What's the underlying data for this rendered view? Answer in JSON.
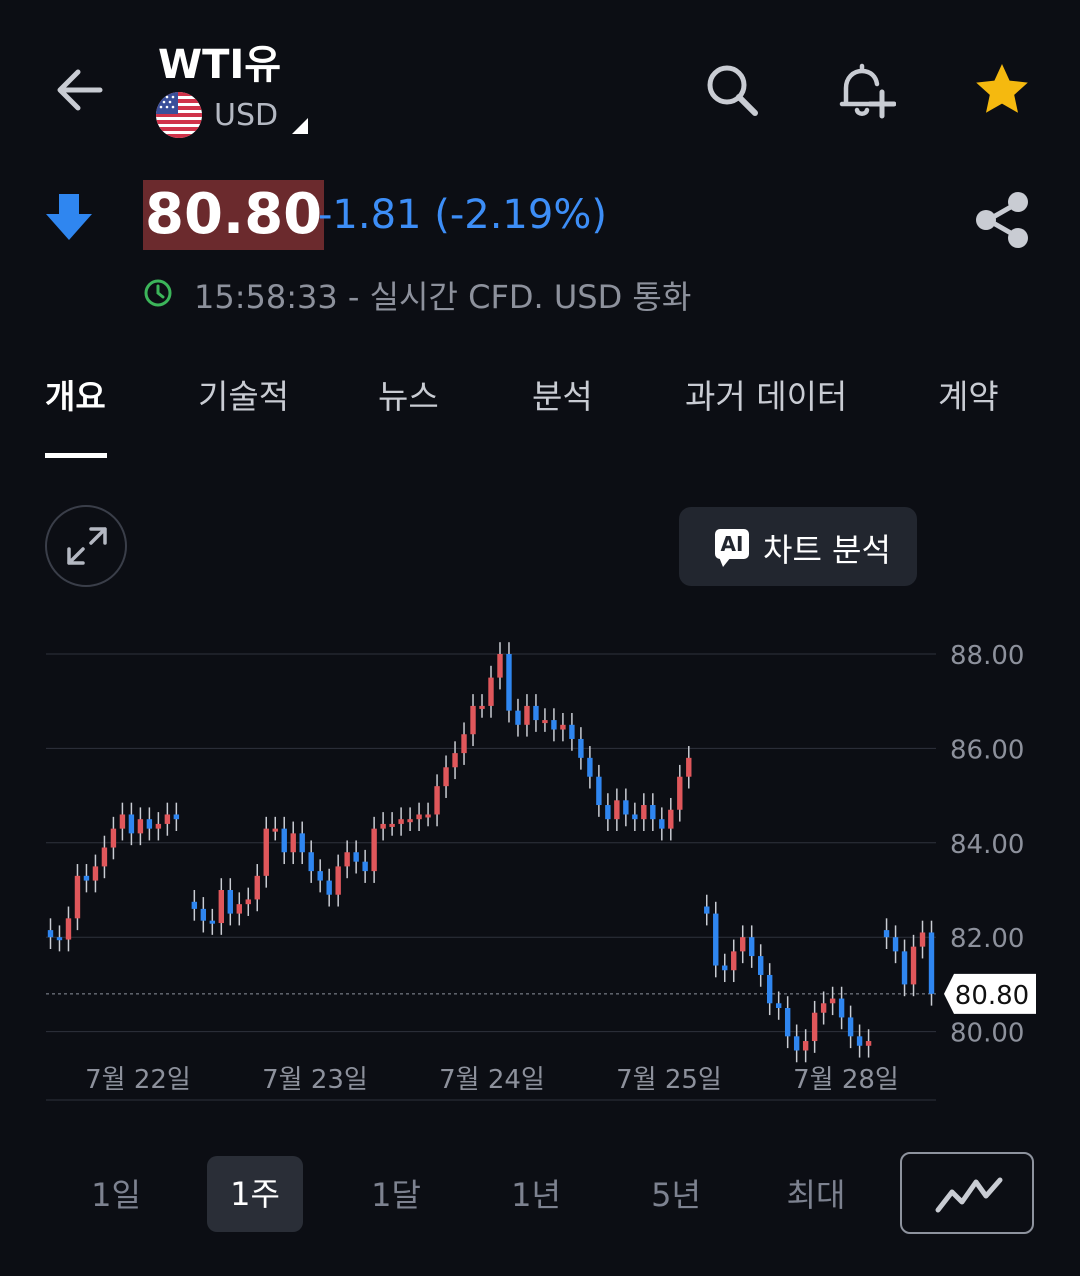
{
  "header": {
    "title": "WTI유",
    "currency": "USD",
    "icons": [
      "back-arrow-icon",
      "search-icon",
      "add-alert-bell-icon",
      "star-icon",
      "share-icon"
    ]
  },
  "quote": {
    "price": "80.80",
    "change": "-1.81 (-2.19%)",
    "status": "15:58:33 - 실시간 CFD. USD 통화"
  },
  "tabs": [
    "개요",
    "기술적",
    "뉴스",
    "분석",
    "과거 데이터",
    "계약"
  ],
  "ai_button": {
    "badge": "AI",
    "label": "차트 분석"
  },
  "ranges": [
    "1일",
    "1주",
    "1달",
    "1년",
    "5년",
    "최대"
  ],
  "colors": {
    "up": "#e0575b",
    "down": "#2f86f0",
    "accent": "#3d8ef7",
    "star": "#f5b90f",
    "price_bg": "#6b2a2d"
  },
  "chart_data": {
    "type": "candlestick",
    "y_ticks": [
      "88.00",
      "86.00",
      "84.00",
      "82.00",
      "80.00"
    ],
    "ylim": [
      79.5,
      88.2
    ],
    "current_value": "80.80",
    "x_labels": [
      "7월 22일",
      "7월 23일",
      "7월 24일",
      "7월 25일",
      "7월 28일"
    ],
    "close_path": [
      82.0,
      81.95,
      82.4,
      83.3,
      83.2,
      83.5,
      83.9,
      84.3,
      84.6,
      84.2,
      84.5,
      84.3,
      84.4,
      84.6,
      84.5,
      null,
      82.6,
      82.35,
      82.3,
      83.0,
      82.5,
      82.7,
      82.8,
      83.3,
      84.3,
      84.3,
      83.8,
      84.2,
      83.8,
      83.4,
      83.2,
      82.9,
      83.5,
      83.8,
      83.6,
      83.4,
      84.3,
      84.4,
      84.4,
      84.5,
      84.5,
      84.6,
      84.6,
      85.2,
      85.6,
      85.9,
      86.3,
      86.9,
      86.9,
      87.5,
      88.0,
      86.8,
      86.5,
      86.9,
      86.6,
      86.6,
      86.4,
      86.5,
      86.2,
      85.8,
      85.4,
      84.8,
      84.5,
      84.9,
      84.6,
      84.5,
      84.8,
      84.5,
      84.3,
      84.7,
      85.4,
      85.8,
      null,
      82.5,
      81.4,
      81.3,
      81.7,
      82.0,
      81.6,
      81.2,
      80.6,
      80.5,
      79.9,
      79.6,
      79.8,
      80.4,
      80.6,
      80.7,
      80.3,
      79.9,
      79.7,
      79.8,
      null,
      82.0,
      81.7,
      81.0,
      81.8,
      82.1,
      80.8
    ],
    "down_color": "#2f86f0",
    "up_color": "#e0575b"
  }
}
